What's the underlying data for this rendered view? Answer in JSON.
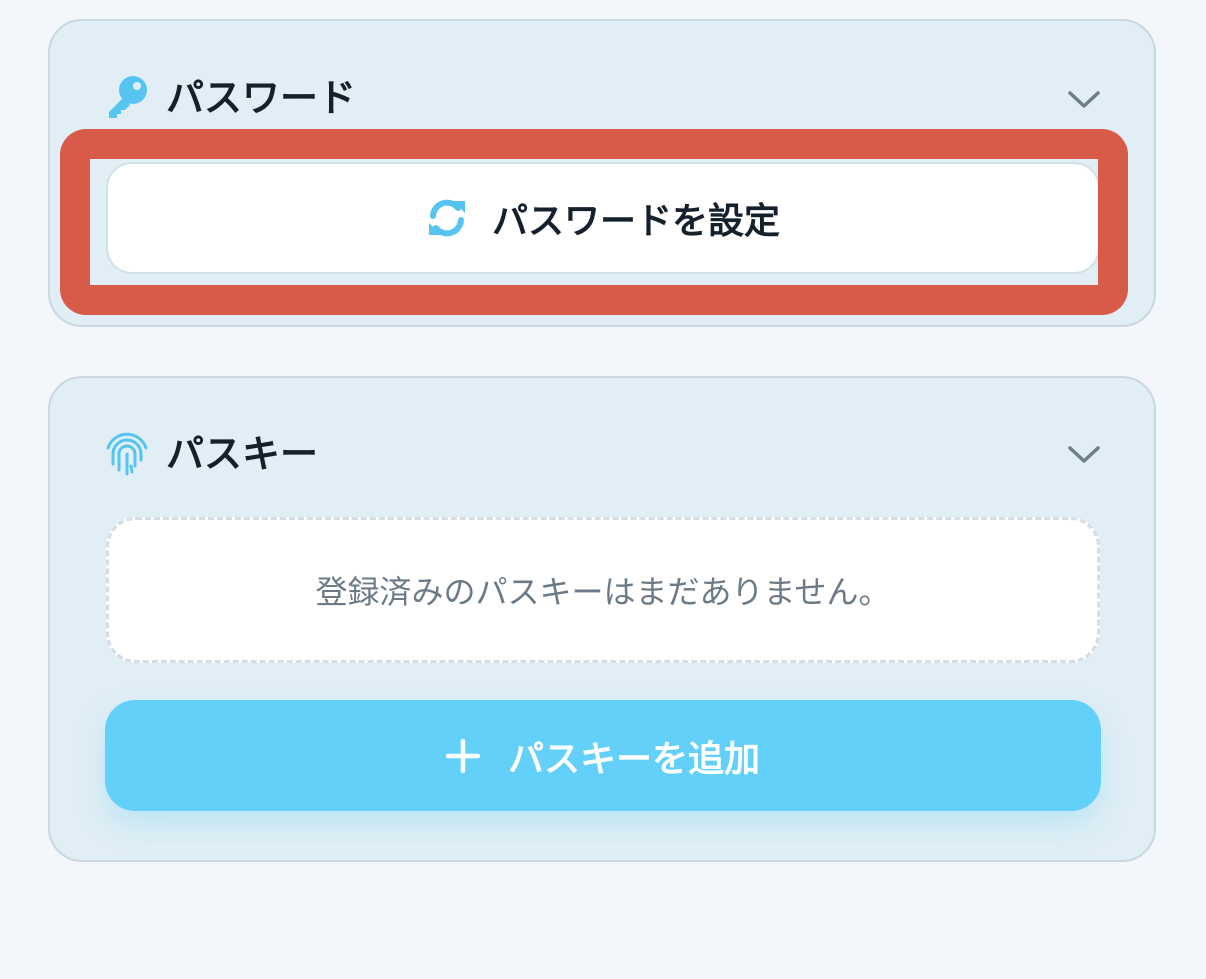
{
  "password_section": {
    "title": "パスワード",
    "icon": "key-icon",
    "set_password_button": {
      "label": "パスワードを設定",
      "icon": "refresh-icon"
    }
  },
  "passkey_section": {
    "title": "パスキー",
    "icon": "fingerprint-icon",
    "empty_message": "登録済みのパスキーはまだありません。",
    "add_button": {
      "label": "パスキーを追加",
      "icon": "plus-icon"
    }
  },
  "colors": {
    "accent": "#62d0f8",
    "highlight": "#d85a48",
    "card_background": "#e1eef5",
    "page_background": "#f3f6fa",
    "text_primary": "#16202c",
    "text_muted": "#6c7a88"
  }
}
